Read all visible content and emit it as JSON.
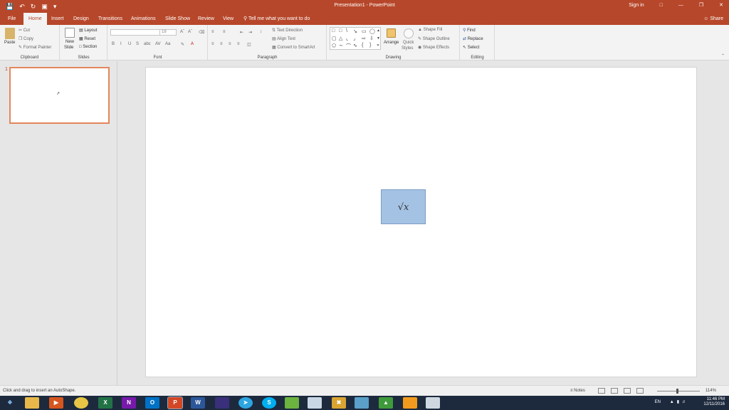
{
  "titlebar": {
    "title": "Presentation1 - PowerPoint",
    "signin": "Sign in",
    "qat_icons": [
      "save-icon",
      "undo-icon",
      "redo-icon",
      "start-from-beginning-icon",
      "customize-icon"
    ]
  },
  "tabs": [
    {
      "label": "File"
    },
    {
      "label": "Home",
      "active": true
    },
    {
      "label": "Insert"
    },
    {
      "label": "Design"
    },
    {
      "label": "Transitions"
    },
    {
      "label": "Animations"
    },
    {
      "label": "Slide Show"
    },
    {
      "label": "Review"
    },
    {
      "label": "View"
    }
  ],
  "tellme": "Tell me what you want to do",
  "share": "Share",
  "ribbon": {
    "clipboard": {
      "label": "Clipboard",
      "paste": "Paste",
      "cut": "Cut",
      "copy": "Copy",
      "format_painter": "Format Painter"
    },
    "slides": {
      "label": "Slides",
      "new_slide_1": "New",
      "new_slide_2": "Slide",
      "layout": "Layout",
      "reset": "Reset",
      "section": "Section"
    },
    "font": {
      "label": "Font",
      "font_size": "18",
      "bold": "B",
      "italic": "I",
      "underline": "U",
      "strike": "S",
      "spacing": "abc",
      "case": "Aa"
    },
    "paragraph": {
      "label": "Paragraph",
      "text_direction": "Text Direction",
      "align_text": "Align Text",
      "convert_smartart": "Convert to SmartArt"
    },
    "drawing": {
      "label": "Drawing",
      "arrange": "Arrange",
      "quick_1": "Quick",
      "quick_2": "Styles",
      "shape_fill": "Shape Fill",
      "shape_outline": "Shape Outline",
      "shape_effects": "Shape Effects"
    },
    "editing": {
      "label": "Editing",
      "find": "Find",
      "replace": "Replace",
      "select": "Select"
    }
  },
  "thumbnail": {
    "number": "1"
  },
  "slide": {
    "equation": "√x",
    "equation_fill": "#a4c2e4"
  },
  "status": {
    "message": "Click and drag to insert an AutoShape.",
    "notes": "Notes",
    "zoom": "114%"
  },
  "taskbar": {
    "language": "EN",
    "time": "11:46 PM",
    "date": "12/11/2016",
    "apps": [
      {
        "name": "start"
      },
      {
        "name": "file-explorer"
      },
      {
        "name": "media-player"
      },
      {
        "name": "chrome"
      },
      {
        "name": "excel",
        "glyph": "X"
      },
      {
        "name": "onenote",
        "glyph": "N"
      },
      {
        "name": "outlook",
        "glyph": "O"
      },
      {
        "name": "powerpoint",
        "glyph": "P"
      },
      {
        "name": "word",
        "glyph": "W"
      },
      {
        "name": "app-purple"
      },
      {
        "name": "telegram"
      },
      {
        "name": "skype",
        "glyph": "S"
      },
      {
        "name": "app-frog"
      },
      {
        "name": "app-doc"
      },
      {
        "name": "app-x"
      },
      {
        "name": "app-book"
      },
      {
        "name": "app-green"
      },
      {
        "name": "app-orange"
      },
      {
        "name": "app-tool"
      }
    ]
  },
  "colors": {
    "accent": "#b7472a",
    "thumb_border": "#e3875b",
    "taskbar": "#1d2a3e"
  }
}
